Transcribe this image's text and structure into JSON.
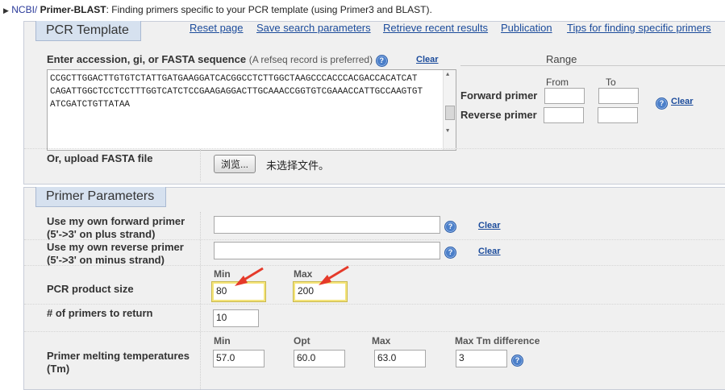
{
  "header": {
    "ncbi": "NCBI/",
    "app": "Primer-BLAST",
    "desc": ": Finding primers specific to your PCR template (using Primer3 and BLAST)."
  },
  "pcr_template": {
    "legend": "PCR Template",
    "links": {
      "reset": "Reset page",
      "save": "Save search parameters",
      "retrieve": "Retrieve recent results",
      "publication": "Publication",
      "tips": "Tips for finding specific primers"
    },
    "seq_label": "Enter accession, gi, or FASTA sequence",
    "seq_hint": "(A refseq record is preferred)",
    "seq_clear": "Clear",
    "sequence": "CCGCTTGGACTTGTGTCTATTGATGAAGGATCACGGCCTCTTGGCTAAGCCCACCCACGACCACATCAT\nCAGATTGGCTCCTCCTTTGGTCATCTCCGAAGAGGACTTGCAAACCGGTGTCGAAACCATTGCCAAGTGT\nATCGATCTGTTATAA",
    "range": {
      "title": "Range",
      "from": "From",
      "to": "To",
      "forward": "Forward primer",
      "reverse": "Reverse primer",
      "clear": "Clear"
    },
    "upload_label": "Or, upload FASTA file",
    "browse_button": "浏览...",
    "no_file": "未选择文件。"
  },
  "primer_params": {
    "legend": "Primer Parameters",
    "own_forward": {
      "line1": "Use my own forward primer",
      "line2": "(5'->3' on plus strand)",
      "clear": "Clear"
    },
    "own_reverse": {
      "line1": "Use my own reverse primer",
      "line2": "(5'->3' on minus strand)",
      "clear": "Clear"
    },
    "product_size": {
      "label": "PCR product size",
      "min_label": "Min",
      "max_label": "Max",
      "min": "80",
      "max": "200"
    },
    "num_primers": {
      "label": "# of primers to return",
      "value": "10"
    },
    "melting": {
      "label1": "Primer melting temperatures",
      "label2": "(Tm)",
      "min_label": "Min",
      "opt_label": "Opt",
      "max_label": "Max",
      "diff_label": "Max Tm difference",
      "min": "57.0",
      "opt": "60.0",
      "max": "63.0",
      "diff": "3"
    }
  },
  "colors": {
    "link": "#1b4b9b",
    "legend_bg": "#d6e1ef",
    "panel_bg": "#f0f0f0",
    "highlight": "#f4e47a",
    "arrow": "#e53a2a"
  }
}
